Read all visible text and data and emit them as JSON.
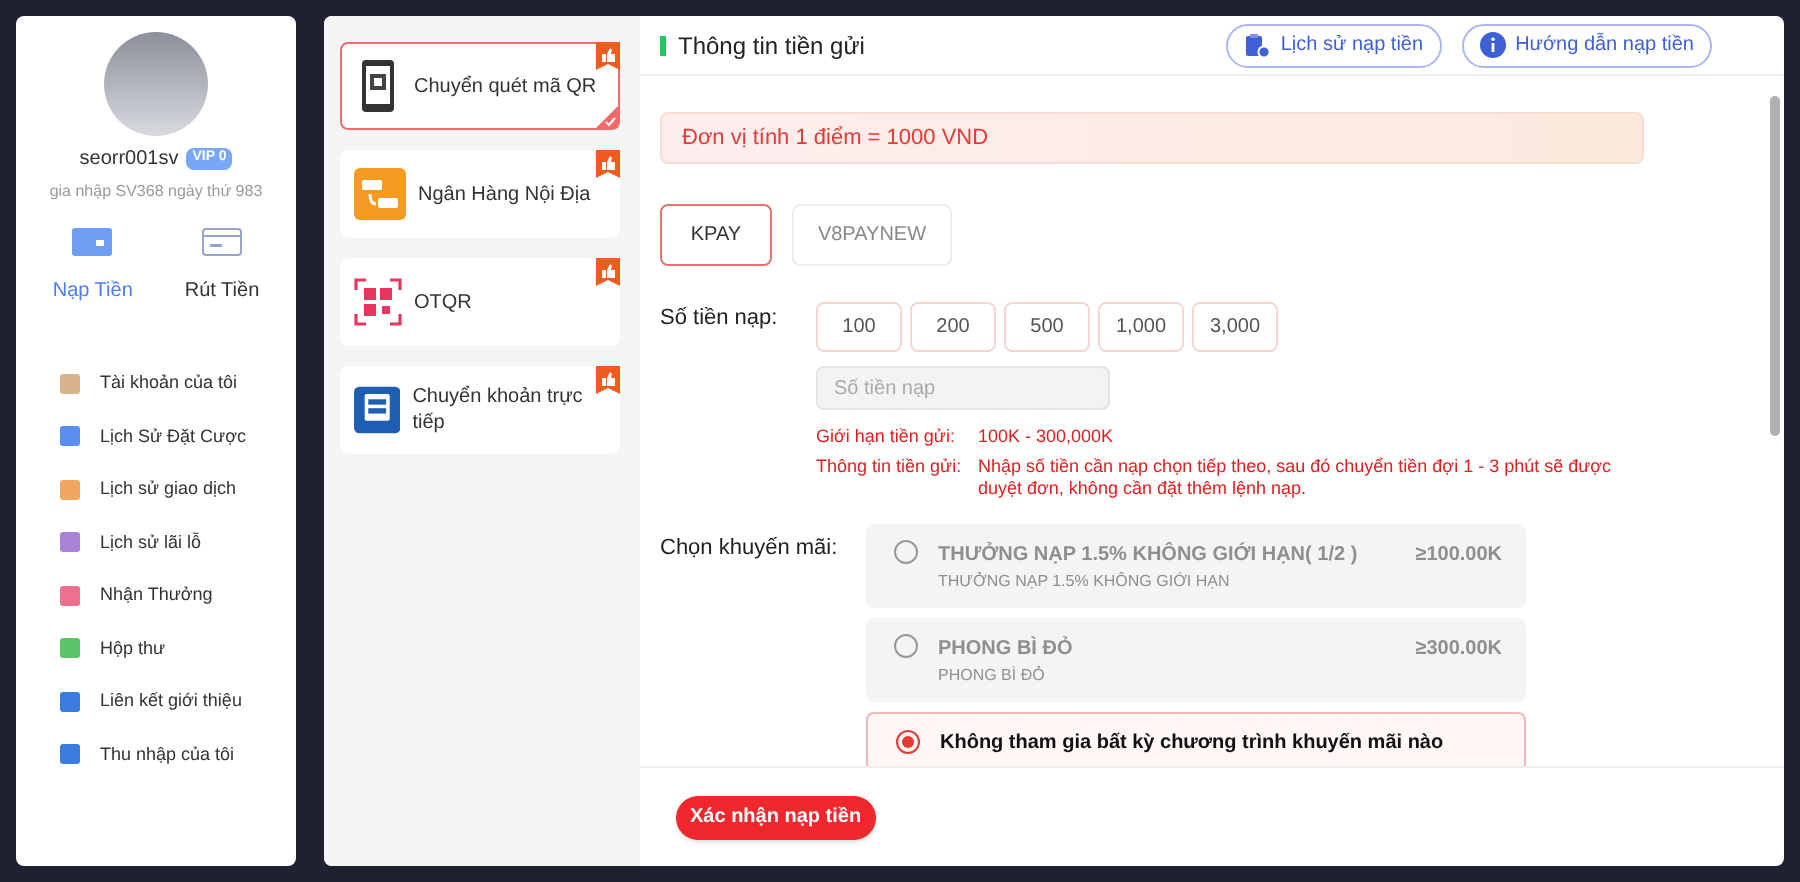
{
  "profile": {
    "username": "seorr001sv",
    "vip_badge": "VIP 0",
    "joined": "gia nhập SV368 ngày thứ 983"
  },
  "wallet_actions": [
    {
      "label": "Nạp Tiền",
      "selected": true
    },
    {
      "label": "Rút Tiền",
      "selected": false
    }
  ],
  "menu": [
    {
      "label": "Tài khoản của tôi",
      "color": "#d9b38c"
    },
    {
      "label": "Lịch Sử Đặt Cược",
      "color": "#5b8def"
    },
    {
      "label": "Lịch sử giao dịch",
      "color": "#f0a860"
    },
    {
      "label": "Lịch sử lãi lỗ",
      "color": "#a982d6"
    },
    {
      "label": "Nhận Thưởng",
      "color": "#ef6f8f"
    },
    {
      "label": "Hộp thư",
      "color": "#5ec46a"
    },
    {
      "label": "Liên kết giới thiệu",
      "color": "#3b7be0"
    },
    {
      "label": "Thu nhập của tôi",
      "color": "#3b7be0"
    }
  ],
  "methods": [
    {
      "label": "Chuyển quét mã QR",
      "kind": "qr-phone",
      "selected": true
    },
    {
      "label": "Ngân Hàng Nội Địa",
      "kind": "bank",
      "selected": false
    },
    {
      "label": "OTQR",
      "kind": "otqr",
      "selected": false
    },
    {
      "label": "Chuyển khoản trực tiếp",
      "kind": "transfer",
      "selected": false
    }
  ],
  "header": {
    "title": "Thông tin tiền gửi",
    "buttons": [
      {
        "label": "Lịch sử nạp tiền",
        "kind": "history"
      },
      {
        "label": "Hướng dẫn nạp tiền",
        "kind": "info"
      }
    ]
  },
  "notice": "Đơn vị tính 1 điểm = 1000 VND",
  "channels": [
    {
      "label": "KPAY",
      "selected": true
    },
    {
      "label": "V8PAYNEW",
      "selected": false
    }
  ],
  "amount": {
    "label": "Số tiền nạp:",
    "presets": [
      {
        "label": "100",
        "selected": false
      },
      {
        "label": "200",
        "selected": false
      },
      {
        "label": "500",
        "selected": false
      },
      {
        "label": "1,000",
        "selected": false
      },
      {
        "label": "3,000",
        "selected": false
      }
    ],
    "placeholder": "Số tiền nạp"
  },
  "limits": [
    {
      "label": "Giới hạn tiền gửi:",
      "value": "100K  -  300,000K"
    },
    {
      "label": "Thông tin tiền gửi:",
      "value": "Nhập số tiền cần nạp chọn tiếp theo, sau đó chuyển tiền đợi 1 - 3 phút sẽ được duyệt đơn, không cần đặt thêm lệnh nạp."
    }
  ],
  "promotions": {
    "label": "Chọn khuyến mãi:",
    "options": [
      {
        "title": "THƯỞNG NẠP 1.5% KHÔNG GIỚI HẠN( 1/2 )",
        "subtitle": "THƯỞNG NẠP 1.5% KHÔNG GIỚI HẠN",
        "minimum": "≥100.00K",
        "disabled": true,
        "selected": false
      },
      {
        "title": "PHONG BÌ ĐỎ",
        "subtitle": "PHONG BÌ ĐỎ",
        "minimum": "≥300.00K",
        "disabled": true,
        "selected": false
      },
      {
        "title": "Không tham gia bất kỳ chương trình khuyến mãi nào",
        "disabled": false,
        "selected": true
      }
    ]
  },
  "submit": "Xác nhận nạp tiền"
}
